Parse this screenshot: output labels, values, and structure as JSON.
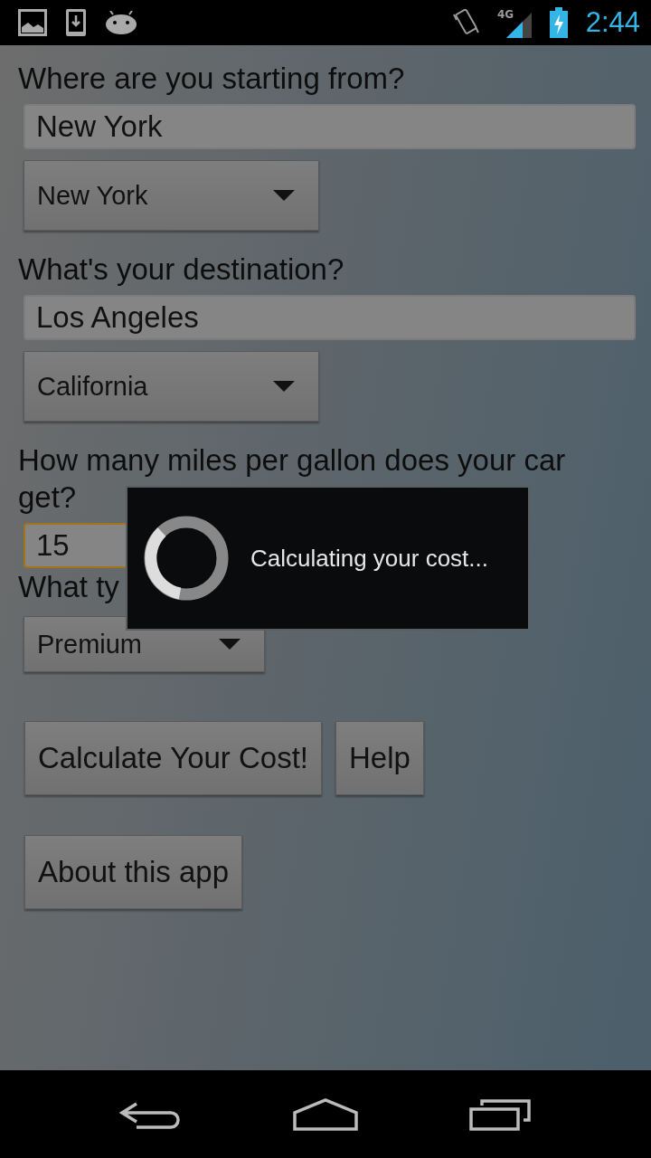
{
  "status_bar": {
    "time": "2:44",
    "network": "4G"
  },
  "form": [
    {
      "kind": "label",
      "text": "Where are you starting from?"
    },
    {
      "kind": "input",
      "value": "New York",
      "focused": false
    },
    {
      "kind": "select",
      "value": "New York"
    },
    {
      "kind": "label",
      "text": "What's your destination?"
    },
    {
      "kind": "input",
      "value": "Los Angeles",
      "focused": false
    },
    {
      "kind": "select",
      "value": "California"
    },
    {
      "kind": "label",
      "text": "How many miles per gallon does your car get?"
    },
    {
      "kind": "short_input",
      "value": "15",
      "focused": true
    },
    {
      "kind": "label",
      "text": "What ty"
    },
    {
      "kind": "short_select",
      "value": "Premium"
    }
  ],
  "buttons": [
    [
      "Calculate Your Cost!",
      "Help"
    ],
    [
      "About this app"
    ]
  ],
  "dialog": {
    "message": "Calculating your cost..."
  }
}
